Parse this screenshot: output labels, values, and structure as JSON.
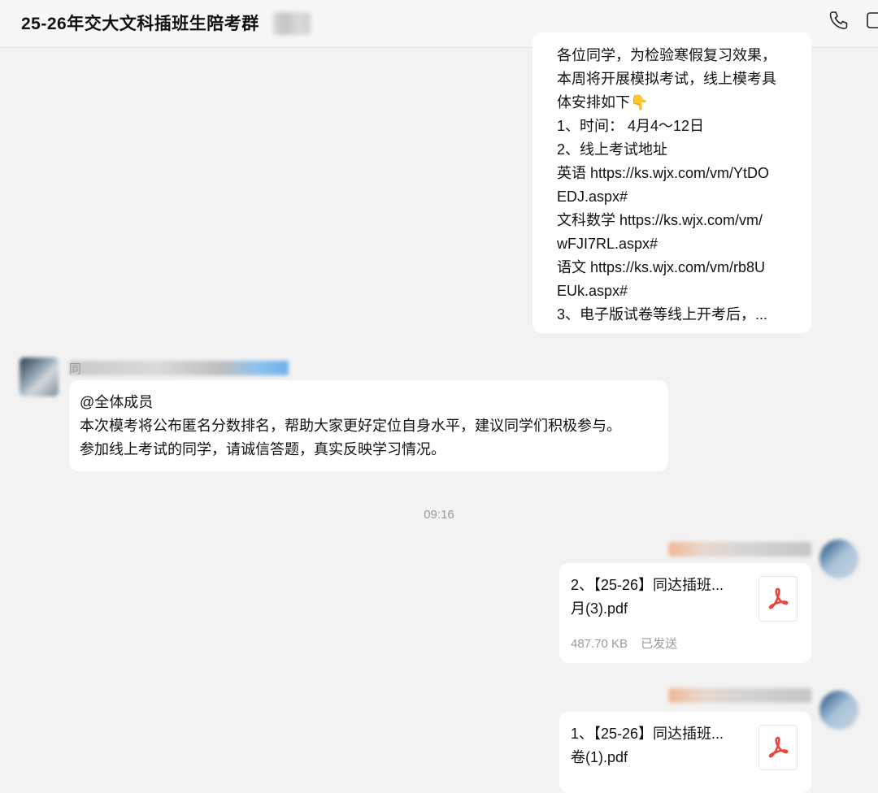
{
  "header": {
    "title": "25-26年交大文科插班生陪考群",
    "icons": [
      "phone-icon",
      "window-icon"
    ]
  },
  "messages": {
    "notice_lines": [
      "各位同学，为检验寒假复习效果，",
      "本周将开展模拟考试，线上模考具",
      "体安排如下👇",
      "1、时间： 4月4～12日",
      "2、线上考试地址",
      "英语 https://ks.wjx.com/vm/YtDO",
      "EDJ.aspx#",
      "文科数学 https://ks.wjx.com/vm/",
      "wFJI7RL.aspx#",
      "语文 https://ks.wjx.com/vm/rb8U",
      "EUk.aspx#",
      "3、电子版试卷等线上开考后，..."
    ],
    "sender_name_visible": "同",
    "mention_lines": [
      "@全体成员",
      "本次模考将公布匿名分数排名，帮助大家更好定位自身水平，建议同学们积极参与。",
      "参加线上考试的同学，请诚信答题，真实反映学习情况。"
    ],
    "timestamp": "09:16"
  },
  "files": [
    {
      "name_line1": "2、【25-26】同达插班...",
      "name_line2": "月(3).pdf",
      "size": "487.70 KB",
      "status": "已发送"
    },
    {
      "name_line1": "1、【25-26】同达插班...",
      "name_line2": "卷(1).pdf"
    }
  ],
  "colors": {
    "pdf_red": "#e8453c",
    "bubble_bg": "#ffffff",
    "chat_bg": "#f2f2f2"
  }
}
